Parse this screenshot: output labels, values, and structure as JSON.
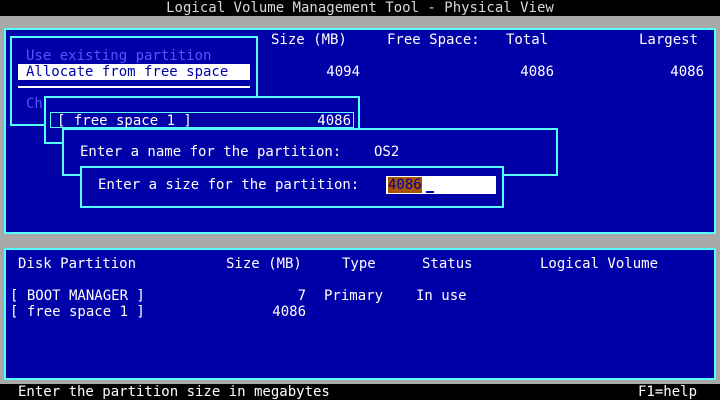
{
  "colors": {
    "desktop": "#a8a8a8",
    "blue": "#0000a8",
    "cyan": "#55ffff",
    "white": "#ffffff",
    "black": "#000000",
    "disabled_text": "#5555ff",
    "highlight_bg": "#a85400",
    "title_text": "#d8d8d8"
  },
  "title": "Logical Volume Management Tool - Physical View",
  "top_panel": {
    "headers": {
      "size": "Size (MB)",
      "free_space": "Free Space:",
      "total": "Total",
      "largest": "Largest"
    },
    "row": {
      "size": "4094",
      "total": "4086",
      "largest": "4086"
    }
  },
  "menu": {
    "items": [
      {
        "label": "Use existing partition",
        "enabled": false
      },
      {
        "label": "Allocate from free space",
        "enabled": true,
        "selected": true
      }
    ],
    "partial_item": "Ch"
  },
  "free_space_box": {
    "label": "[ free space 1 ]",
    "size": "4086"
  },
  "name_dialog": {
    "prompt": "Enter a name for the partition:",
    "value": "OS2"
  },
  "size_dialog": {
    "prompt": "Enter a size for the partition:",
    "value": "4086"
  },
  "bottom_panel": {
    "headers": {
      "disk_partition": "Disk Partition",
      "size": "Size (MB)",
      "type": "Type",
      "status": "Status",
      "logical_volume": "Logical Volume"
    },
    "rows": [
      {
        "name": "[ BOOT MANAGER ]",
        "size": "7",
        "type": "Primary",
        "status": "In use"
      },
      {
        "name": "[ free space 1 ]",
        "size": "4086",
        "type": "",
        "status": ""
      }
    ]
  },
  "status_bar": {
    "hint": "Enter the partition size in megabytes",
    "help": "F1=help"
  }
}
